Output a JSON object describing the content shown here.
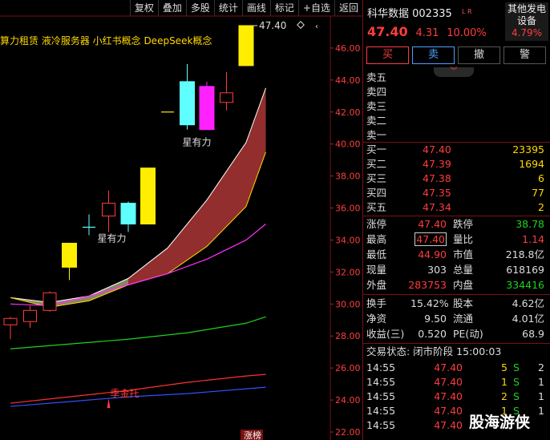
{
  "toolbar": [
    "复权",
    "叠加",
    "多股",
    "统计",
    "画线",
    "标记",
    "+自选",
    "返回"
  ],
  "concepts": "算力租赁  液冷服务器  小红书概念  DeepSeek概念",
  "chart_data": {
    "type": "candlestick",
    "y_ticks": [
      "46.00",
      "44.00",
      "42.00",
      "40.00",
      "38.00",
      "36.00",
      "34.00",
      "32.00",
      "30.00",
      "28.00",
      "26.00",
      "24.00",
      "22.00"
    ],
    "ylim": [
      21.5,
      48.0
    ],
    "high_label": "47.40",
    "annotations": [
      "星有力",
      "星有力",
      "季金托"
    ],
    "bottom_badge": "涨榜",
    "candles": [
      {
        "o": 28.7,
        "c": 29.1,
        "h": 29.2,
        "l": 27.8,
        "color": "red"
      },
      {
        "o": 28.9,
        "c": 29.6,
        "h": 29.9,
        "l": 28.5,
        "color": "red"
      },
      {
        "o": 29.6,
        "c": 30.7,
        "h": 30.8,
        "l": 29.5,
        "color": "red"
      },
      {
        "o": 33.8,
        "c": 32.3,
        "h": 33.8,
        "l": 31.5,
        "color": "yellow"
      },
      {
        "o": 34.8,
        "c": 34.8,
        "h": 35.6,
        "l": 34.3,
        "color": "cross"
      },
      {
        "o": 35.5,
        "c": 36.3,
        "h": 37.1,
        "l": 34.5,
        "color": "red"
      },
      {
        "o": 35.0,
        "c": 36.3,
        "h": 36.4,
        "l": 34.5,
        "color": "cyan"
      },
      {
        "o": 35.0,
        "c": 38.5,
        "h": 38.5,
        "l": 35.0,
        "color": "yellow"
      },
      {
        "o": 42.0,
        "c": 42.0,
        "h": 42.0,
        "l": 42.0,
        "color": "dash"
      },
      {
        "o": 43.9,
        "c": 41.2,
        "h": 45.0,
        "l": 40.9,
        "color": "cyan"
      },
      {
        "o": 43.6,
        "c": 40.9,
        "h": 43.9,
        "l": 40.9,
        "color": "magenta"
      },
      {
        "o": 42.6,
        "c": 43.2,
        "h": 44.5,
        "l": 42.1,
        "color": "red"
      },
      {
        "o": 44.9,
        "c": 47.4,
        "h": 47.4,
        "l": 44.9,
        "color": "yellow"
      }
    ],
    "band_upper": [
      [
        0,
        30.4
      ],
      [
        2,
        30.1
      ],
      [
        4,
        30.5
      ],
      [
        6,
        31.6
      ],
      [
        8,
        33.5
      ],
      [
        10,
        36.5
      ],
      [
        12,
        40.1
      ],
      [
        13,
        43.5
      ]
    ],
    "band_lower": [
      [
        0,
        30.4
      ],
      [
        2,
        29.8
      ],
      [
        4,
        30.2
      ],
      [
        6,
        31.2
      ],
      [
        8,
        31.9
      ],
      [
        10,
        33.6
      ],
      [
        12,
        36.1
      ],
      [
        13,
        39.5
      ]
    ],
    "ma_magenta": [
      [
        0,
        30.0
      ],
      [
        2,
        29.9
      ],
      [
        4,
        30.5
      ],
      [
        6,
        31.2
      ],
      [
        8,
        31.9
      ],
      [
        10,
        32.8
      ],
      [
        12,
        34.0
      ],
      [
        13,
        35.0
      ]
    ],
    "ma_green": [
      [
        0,
        27.2
      ],
      [
        3,
        27.5
      ],
      [
        6,
        27.8
      ],
      [
        9,
        28.2
      ],
      [
        12,
        28.8
      ],
      [
        13,
        29.2
      ]
    ],
    "ma_red": [
      [
        0,
        23.8
      ],
      [
        3,
        24.2
      ],
      [
        6,
        24.6
      ],
      [
        9,
        25.1
      ],
      [
        12,
        25.5
      ],
      [
        13,
        25.6
      ]
    ],
    "ma_blue": [
      [
        0,
        23.6
      ],
      [
        3,
        23.9
      ],
      [
        6,
        24.2
      ],
      [
        9,
        24.4
      ],
      [
        12,
        24.7
      ],
      [
        13,
        24.8
      ]
    ]
  },
  "stock": {
    "name": "科华数据 002335",
    "tag": "L R",
    "price": "47.40",
    "change": "4.31",
    "pct": "10.00%",
    "sector_name": "其他发电设备",
    "sector_pct": "4.79%"
  },
  "buttons": {
    "buy": "买",
    "sell": "卖",
    "cancel": "撤",
    "alert": "警"
  },
  "expand_glyph": "︾",
  "asks": [
    {
      "label": "卖五",
      "price": "",
      "vol": ""
    },
    {
      "label": "卖四",
      "price": "",
      "vol": ""
    },
    {
      "label": "卖三",
      "price": "",
      "vol": ""
    },
    {
      "label": "卖二",
      "price": "",
      "vol": ""
    },
    {
      "label": "卖一",
      "price": "",
      "vol": ""
    }
  ],
  "bids": [
    {
      "label": "买一",
      "price": "47.40",
      "vol": "23395"
    },
    {
      "label": "买二",
      "price": "47.39",
      "vol": "1694"
    },
    {
      "label": "买三",
      "price": "47.38",
      "vol": "6"
    },
    {
      "label": "买四",
      "price": "47.35",
      "vol": "77"
    },
    {
      "label": "买五",
      "price": "47.34",
      "vol": "2"
    }
  ],
  "stats": [
    {
      "l1": "涨停",
      "v1": "47.40",
      "c1": "red",
      "l2": "跌停",
      "v2": "38.78",
      "c2": "green"
    },
    {
      "l1": "最高",
      "v1": "47.40",
      "c1": "red",
      "l2": "量比",
      "v2": "1.14",
      "c2": "red"
    },
    {
      "l1": "最低",
      "v1": "44.90",
      "c1": "red",
      "l2": "市值",
      "v2": "218.8亿",
      "c2": "white"
    },
    {
      "l1": "现量",
      "v1": "303",
      "c1": "white",
      "l2": "总量",
      "v2": "618169",
      "c2": "white"
    },
    {
      "l1": "外盘",
      "v1": "283753",
      "c1": "red",
      "l2": "内盘",
      "v2": "334416",
      "c2": "green"
    }
  ],
  "stats2": [
    {
      "l1": "换手",
      "v1": "15.42%",
      "l2": "股本",
      "v2": "4.62亿"
    },
    {
      "l1": "净资",
      "v1": "9.50",
      "l2": "流通",
      "v2": "4.01亿"
    },
    {
      "l1": "收益(三)",
      "v1": "0.520",
      "l2": "PE(动)",
      "v2": "68.9"
    }
  ],
  "trade_status": "交易状态: 闭市阶段 15:00:03",
  "ticks": [
    {
      "time": "14:55",
      "price": "47.40",
      "vol": "5",
      "side": "S",
      "num": "2"
    },
    {
      "time": "14:55",
      "price": "47.40",
      "vol": "1",
      "side": "S",
      "num": "1"
    },
    {
      "time": "14:55",
      "price": "47.40",
      "vol": "2",
      "side": "S",
      "num": "1"
    },
    {
      "time": "14:55",
      "price": "47.40",
      "vol": "1",
      "side": "S",
      "num": "1"
    },
    {
      "time": "14:55",
      "price": "47.40",
      "vol": "",
      "side": "",
      "num": ""
    }
  ],
  "watermark": "股海游侠"
}
